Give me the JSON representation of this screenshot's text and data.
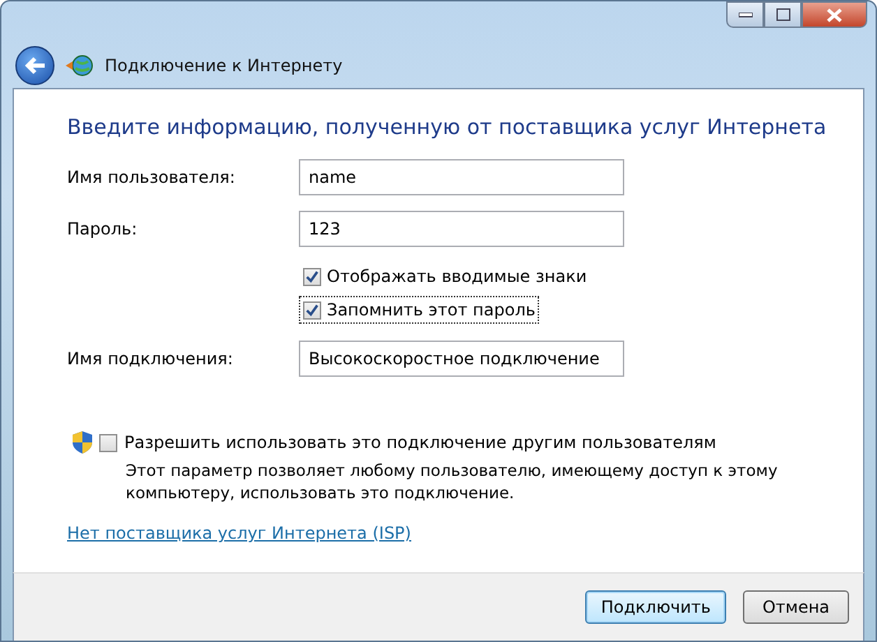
{
  "window": {
    "title": "Подключение к Интернету"
  },
  "heading": "Введите информацию, полученную от поставщика услуг Интернета",
  "fields": [
    {
      "label": "Имя пользователя:",
      "value": "name"
    },
    {
      "label": "Пароль:",
      "value": "123"
    }
  ],
  "options": [
    {
      "label": "Отображать вводимые знаки",
      "checked": true,
      "focused": false
    },
    {
      "label": "Запомнить этот пароль",
      "checked": true,
      "focused": true
    }
  ],
  "connection_name": {
    "label": "Имя подключения:",
    "value": "Высокоскоростное подключение"
  },
  "share": {
    "label": "Разрешить использовать это подключение другим пользователям",
    "checked": false,
    "description": "Этот параметр позволяет любому пользователю, имеющему доступ к этому компьютеру, использовать это подключение."
  },
  "link": "Нет поставщика услуг Интернета (ISP)",
  "buttons": [
    {
      "label": "Подключить",
      "default": true
    },
    {
      "label": "Отмена",
      "default": false
    }
  ]
}
